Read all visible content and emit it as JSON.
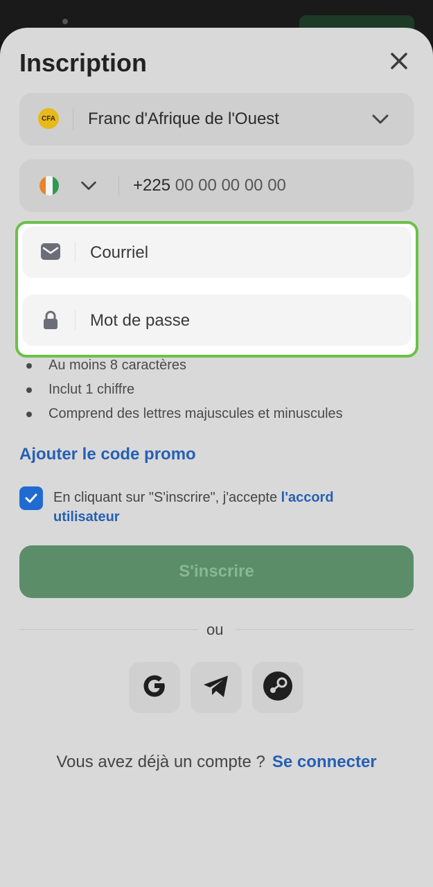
{
  "form": {
    "title": "Inscription",
    "currency": {
      "badge": "CFA",
      "label": "Franc d'Afrique de l'Ouest"
    },
    "phone": {
      "code": "+225",
      "placeholder": "00 00 00 00 00"
    },
    "email": {
      "placeholder": "Courriel"
    },
    "password": {
      "placeholder": "Mot de passe"
    },
    "password_rules": [
      "Au moins 8 caractères",
      "Inclut 1 chiffre",
      "Comprend des lettres majuscules et minuscules"
    ],
    "promo_label": "Ajouter le code promo",
    "agreement": {
      "text": "En cliquant sur \"S'inscrire\", j'accepte ",
      "link": "l'accord utilisateur",
      "checked": true
    },
    "submit_label": "S'inscrire",
    "divider_label": "ou",
    "social": [
      "google-icon",
      "telegram-icon",
      "steam-icon"
    ],
    "footer": {
      "question": "Vous avez déjà un compte ?",
      "login_link": "Se connecter"
    }
  },
  "colors": {
    "accent_blue": "#2560b5",
    "checkbox_blue": "#1f6bd1",
    "submit_green": "#5a8d68",
    "highlight_green": "#6cc04a",
    "cfa_gold": "#e7b91b"
  }
}
